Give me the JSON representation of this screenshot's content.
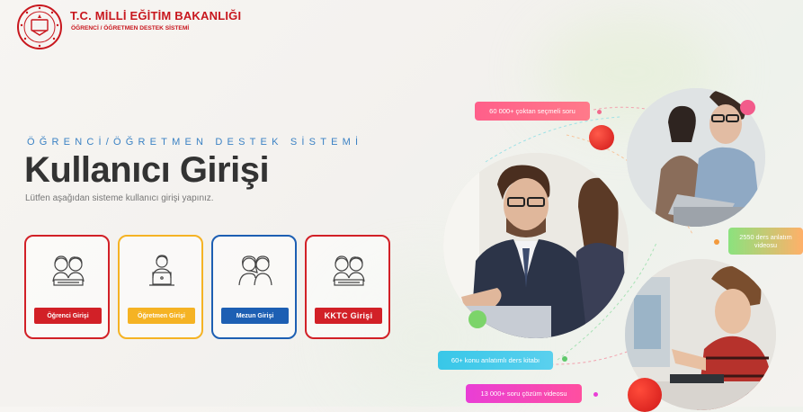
{
  "header": {
    "title": "T.C. MİLLİ EĞİTİM BAKANLIĞI",
    "subtitle": "ÖĞRENCİ / ÖĞRETMEN DESTEK SİSTEMİ"
  },
  "hero": {
    "kicker": "ÖĞRENCİ/ÖĞRETMEN DESTEK SİSTEMİ",
    "title": "Kullanıcı Girişi",
    "subtitle": "Lütfen aşağıdan sisteme kullanıcı girişi yapınız."
  },
  "login_cards": [
    {
      "label": "Öğrenci Girişi",
      "color": "#d22027",
      "icon": "students-icon"
    },
    {
      "label": "Öğretmen Girişi",
      "color": "#f5b324",
      "icon": "teacher-laptop-icon"
    },
    {
      "label": "Mezun Girişi",
      "color": "#1d5fb3",
      "icon": "graduates-icon"
    },
    {
      "label": "KKTC Girişi",
      "color": "#d22027",
      "icon": "students-icon"
    }
  ],
  "stats": {
    "questions": "60 000+ çoktan seçmeli soru",
    "lessons": "2550 ders anlatım videosu",
    "books": "60+ konu anlatımlı ders kitabı",
    "solutions": "13 000+ soru çözüm videosu"
  },
  "colors": {
    "brand_red": "#c8171e",
    "pink": "#ff5f8a",
    "green": "#6cd56c",
    "cyan": "#38c7e8",
    "magenta": "#e93ed6"
  }
}
